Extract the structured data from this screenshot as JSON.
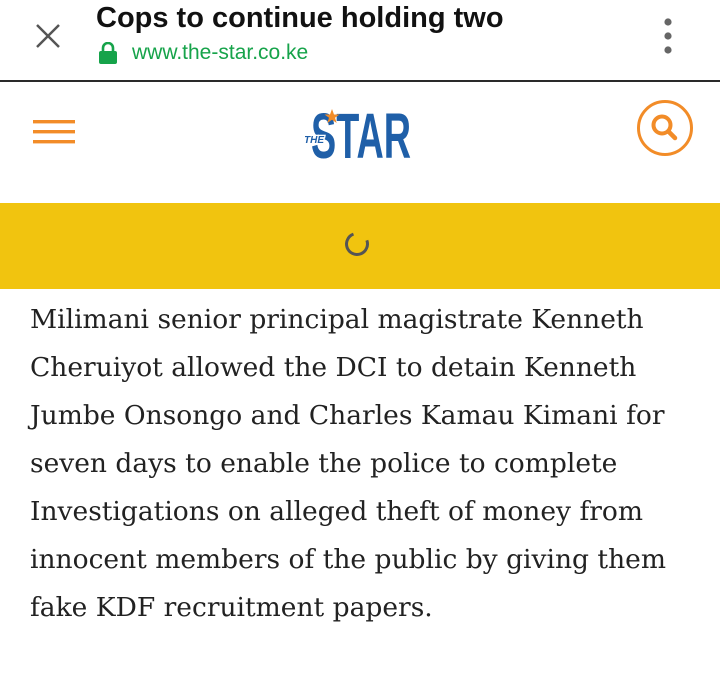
{
  "browser": {
    "title": "Cops to continue holding two",
    "url": "www.the-star.co.ke",
    "icons": {
      "close": "close-icon",
      "secure": "lock-icon",
      "menu": "more-vert-icon"
    }
  },
  "site": {
    "logo_the": "THE",
    "logo_star": "STAR",
    "icons": {
      "menu": "hamburger-icon",
      "search": "search-icon"
    },
    "colors": {
      "accent": "#f28c28",
      "logo_blue": "#1f5fa8",
      "ad_band": "#f1c40f",
      "secure_green": "#16a34a"
    }
  },
  "ad": {
    "state": "loading",
    "icon": "loading-spinner-icon"
  },
  "article": {
    "paragraph": "Milimani senior principal magistrate Kenneth Cheruiyot allowed the DCI to detain Kenneth Jumbe Onsongo and Charles Kamau Kimani for seven days to enable the police to complete Investigations on alleged theft of money from innocent members of the public by giving them fake KDF recruitment papers."
  }
}
